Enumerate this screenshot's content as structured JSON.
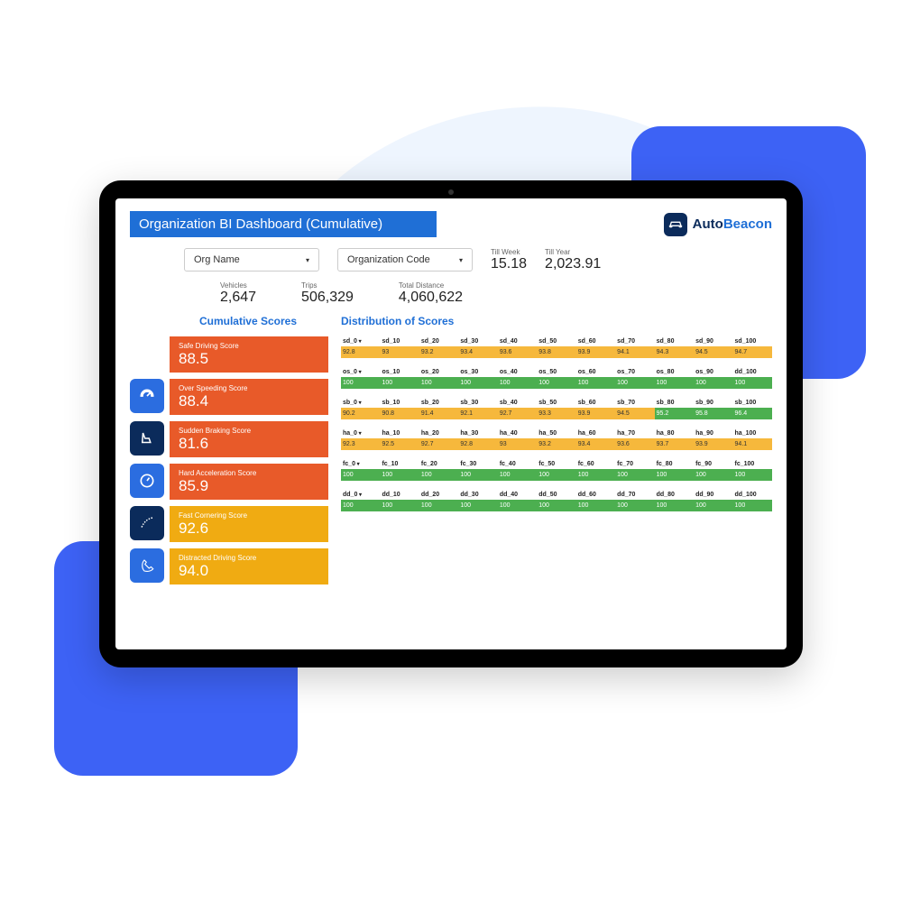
{
  "header": {
    "title": "Organization BI Dashboard (Cumulative)"
  },
  "brand": {
    "auto": "Auto",
    "beacon": "Beacon"
  },
  "filters": {
    "org_name_label": "Org Name",
    "org_code_label": "Organization Code",
    "till_week_label": "Till Week",
    "till_week_val": "15.18",
    "till_year_label": "Till Year",
    "till_year_val": "2,023.91"
  },
  "summary": {
    "vehicles_label": "Vehicles",
    "vehicles": "2,647",
    "trips_label": "Trips",
    "trips": "506,329",
    "distance_label": "Total Distance",
    "distance": "4,060,622"
  },
  "cumulative_title": "Cumulative Scores",
  "distribution_title": "Distribution of  Scores",
  "scores": {
    "sd_name": "Safe Driving Score",
    "sd_val": "88.5",
    "os_name": "Over Speeding Score",
    "os_val": "88.4",
    "sb_name": "Sudden Braking Score",
    "sb_val": "81.6",
    "ha_name": "Hard Acceleration Score",
    "ha_val": "85.9",
    "fc_name": "Fast Cornering Score",
    "fc_val": "92.6",
    "dd_name": "Distracted Driving Score",
    "dd_val": "94.0"
  },
  "dist": {
    "sd": {
      "h": [
        "sd_0",
        "sd_10",
        "sd_20",
        "sd_30",
        "sd_40",
        "sd_50",
        "sd_60",
        "sd_70",
        "sd_80",
        "sd_90",
        "sd_100"
      ],
      "v": [
        "92.8",
        "93",
        "93.2",
        "93.4",
        "93.6",
        "93.8",
        "93.9",
        "94.1",
        "94.3",
        "94.5",
        "94.7"
      ]
    },
    "os": {
      "h": [
        "os_0",
        "os_10",
        "os_20",
        "os_30",
        "os_40",
        "os_50",
        "os_60",
        "os_70",
        "os_80",
        "os_90",
        "dd_100"
      ],
      "v": [
        "100",
        "100",
        "100",
        "100",
        "100",
        "100",
        "100",
        "100",
        "100",
        "100",
        "100"
      ]
    },
    "sb": {
      "h": [
        "sb_0",
        "sb_10",
        "sb_20",
        "sb_30",
        "sb_40",
        "sb_50",
        "sb_60",
        "sb_70",
        "sb_80",
        "sb_90",
        "sb_100"
      ],
      "v": [
        "90.2",
        "90.8",
        "91.4",
        "92.1",
        "92.7",
        "93.3",
        "93.9",
        "94.5",
        "95.2",
        "95.8",
        "96.4"
      ]
    },
    "ha": {
      "h": [
        "ha_0",
        "ha_10",
        "ha_20",
        "ha_30",
        "ha_40",
        "ha_50",
        "ha_60",
        "ha_70",
        "ha_80",
        "ha_90",
        "ha_100"
      ],
      "v": [
        "92.3",
        "92.5",
        "92.7",
        "92.8",
        "93",
        "93.2",
        "93.4",
        "93.6",
        "93.7",
        "93.9",
        "94.1"
      ]
    },
    "fc": {
      "h": [
        "fc_0",
        "fc_10",
        "fc_20",
        "fc_30",
        "fc_40",
        "fc_50",
        "fc_60",
        "fc_70",
        "fc_80",
        "fc_90",
        "fc_100"
      ],
      "v": [
        "100",
        "100",
        "100",
        "100",
        "100",
        "100",
        "100",
        "100",
        "100",
        "100",
        "100"
      ]
    },
    "dd": {
      "h": [
        "dd_0",
        "dd_10",
        "dd_20",
        "dd_30",
        "dd_40",
        "dd_50",
        "dd_60",
        "dd_70",
        "dd_80",
        "dd_90",
        "dd_100"
      ],
      "v": [
        "100",
        "100",
        "100",
        "100",
        "100",
        "100",
        "100",
        "100",
        "100",
        "100",
        "100"
      ]
    }
  }
}
